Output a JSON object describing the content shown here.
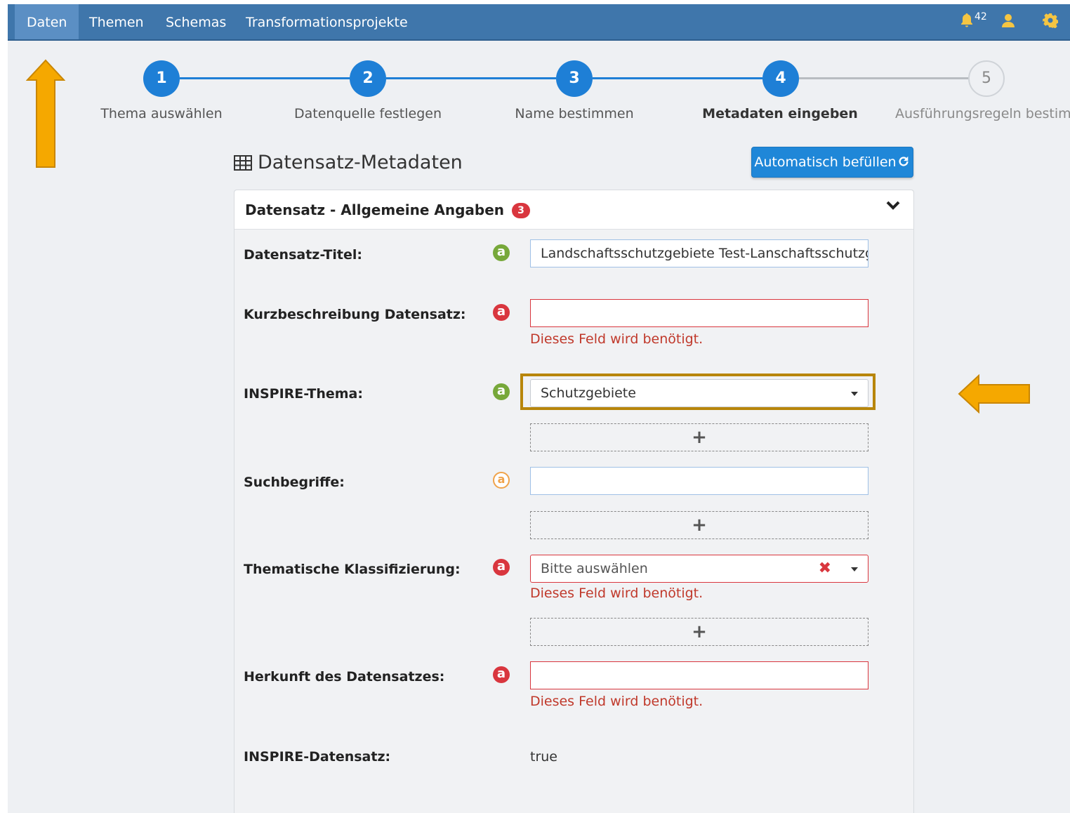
{
  "nav": {
    "items": [
      "Daten",
      "Themen",
      "Schemas",
      "Transformationsprojekte"
    ],
    "notifications_count": "42",
    "icons": [
      "bell-icon",
      "user-icon",
      "gear-icon"
    ]
  },
  "stepper": {
    "steps": [
      {
        "number": "1",
        "label": "Thema auswählen",
        "state": "done"
      },
      {
        "number": "2",
        "label": "Datenquelle festlegen",
        "state": "done"
      },
      {
        "number": "3",
        "label": "Name bestimmen",
        "state": "done"
      },
      {
        "number": "4",
        "label": "Metadaten eingeben",
        "state": "current"
      },
      {
        "number": "5",
        "label": "Ausführungsregeln bestimme",
        "state": "todo"
      }
    ]
  },
  "section": {
    "title": "Datensatz-Metadaten",
    "auto_fill_label": "Automatisch befüllen"
  },
  "panel": {
    "title": "Datensatz - Allgemeine Angaben",
    "badge": "3"
  },
  "fields": {
    "titel": {
      "label": "Datensatz-Titel:",
      "value": "Landschaftsschutzgebiete Test-Lanschaftsschutzg",
      "status": "green"
    },
    "kurzbeschreibung": {
      "label": "Kurzbeschreibung Datensatz:",
      "value": "",
      "error": "Dieses Feld wird benötigt.",
      "status": "red"
    },
    "inspire_thema": {
      "label": "INSPIRE-Thema:",
      "value": "Schutzgebiete",
      "status": "green"
    },
    "suchbegriffe": {
      "label": "Suchbegriffe:",
      "value": "",
      "status": "orange"
    },
    "klassifizierung": {
      "label": "Thematische Klassifizierung:",
      "placeholder": "Bitte auswählen",
      "error": "Dieses Feld wird benötigt.",
      "status": "red"
    },
    "herkunft": {
      "label": "Herkunft des Datensatzes:",
      "value": "",
      "error": "Dieses Feld wird benötigt.",
      "status": "red"
    },
    "inspire_datensatz": {
      "label": "INSPIRE-Datensatz:",
      "value": "true"
    }
  },
  "add_symbol": "+",
  "at_symbol": "a",
  "colors": {
    "navbar": "#3f76ab",
    "step_active": "#1e7fd6",
    "error": "#d9363e",
    "ok": "#77a83a",
    "warn": "#f0a34a",
    "arrow": "#f5a800",
    "highlight": "#b8860b"
  }
}
